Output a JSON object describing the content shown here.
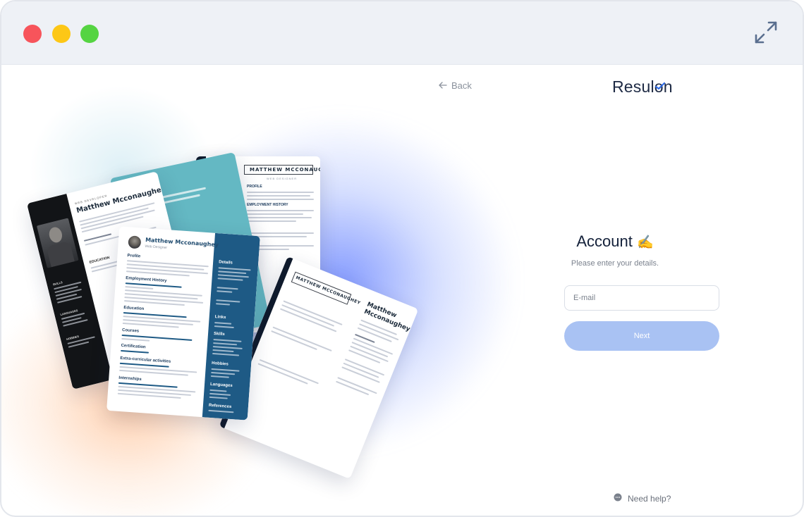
{
  "window": {
    "controls": [
      "close",
      "minimize",
      "maximize"
    ],
    "expand_icon": "expand-arrows-icon"
  },
  "colors": {
    "accent": "#a9c2f3",
    "logo_check": "#2e6be6",
    "resume_blue": "#1e5a85",
    "resume_teal": "#64b8c3"
  },
  "nav": {
    "back_label": "Back"
  },
  "brand": {
    "logo_text": "Resulon"
  },
  "form": {
    "title": "Account",
    "title_emoji": "✍️",
    "subtitle": "Please enter your details.",
    "email_placeholder": "E-mail",
    "next_label": "Next"
  },
  "help": {
    "label": "Need help?"
  },
  "resumes": {
    "name": "Matthew Mcconaughey",
    "name_upper": "MATTHEW MCCONAUGHEY",
    "role": "Web Designer",
    "role_upper": "WEB DESIGNER",
    "role_dark": "WEB DEVELOPER",
    "name_split_first": "Matthew",
    "name_split_last": "Mcconaughey",
    "sections": {
      "profile": "Profile",
      "profile_upper": "PROFILE",
      "employment": "Employment History",
      "employment_upper": "EMPLOYMENT HISTORY",
      "education": "Education",
      "education_upper": "EDUCATION",
      "courses": "Courses",
      "certification": "Certification",
      "extra": "Extra-curricular activities",
      "internships": "Internships",
      "details": "Details",
      "links": "Links",
      "skills": "Skills",
      "hobbies": "Hobbies",
      "languages": "Languages",
      "references": "References",
      "skills_upper": "SKILLS",
      "languages_upper": "LANGUAGES",
      "hobbies_upper": "HOBBIES"
    }
  }
}
